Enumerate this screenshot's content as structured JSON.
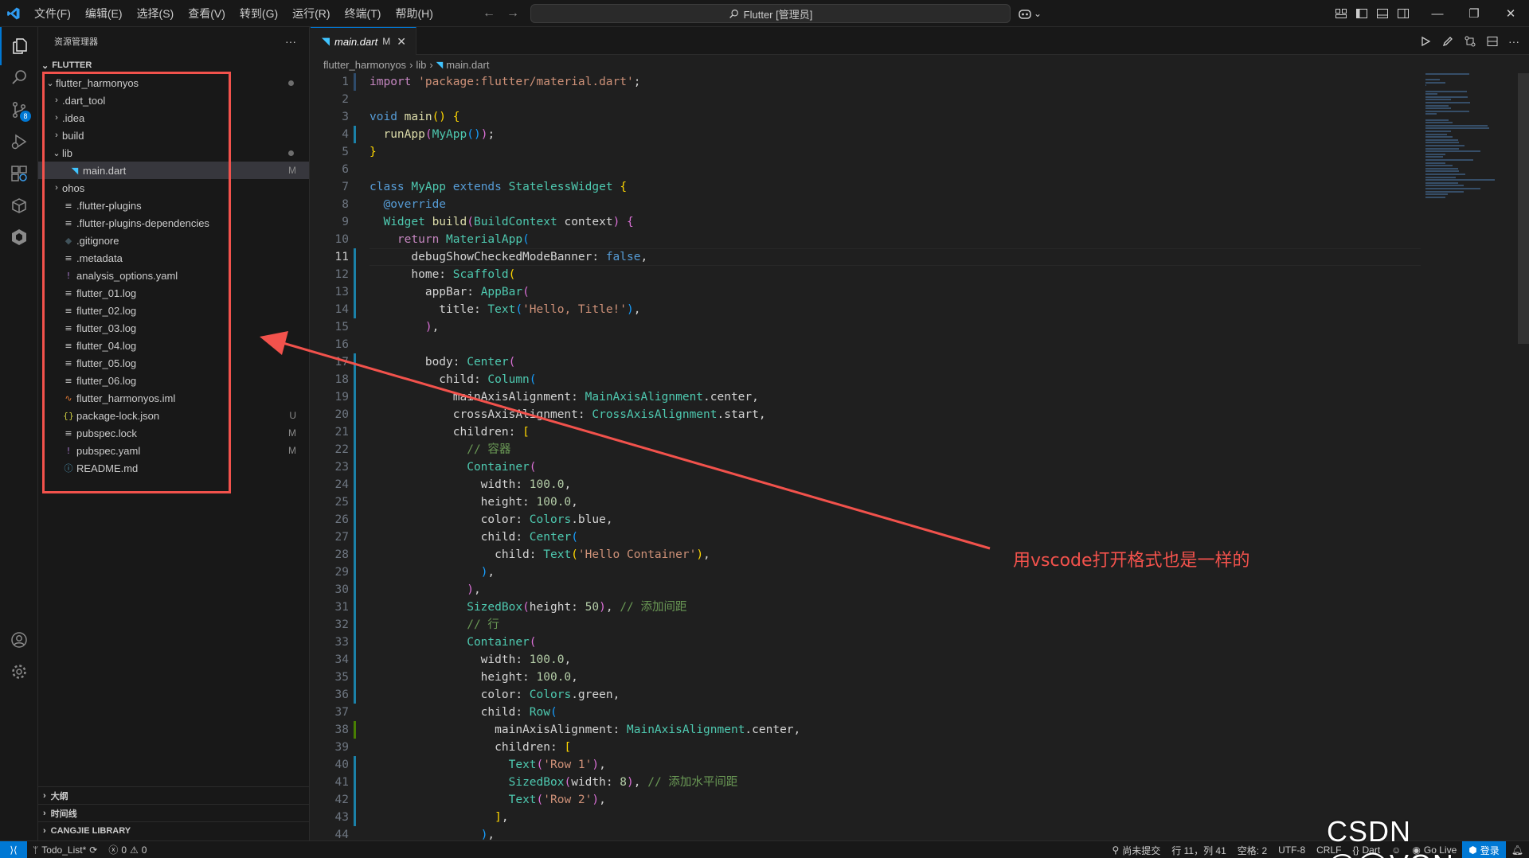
{
  "titlebar": {
    "menus": [
      "文件(F)",
      "编辑(E)",
      "选择(S)",
      "查看(V)",
      "转到(G)",
      "运行(R)",
      "终端(T)",
      "帮助(H)"
    ],
    "command_center": "Flutter [管理员]"
  },
  "explorer": {
    "title": "资源管理器",
    "workspace": "FLUTTER",
    "items": [
      {
        "label": "flutter_harmonyos",
        "depth": 0,
        "kind": "folder-open",
        "dot": true
      },
      {
        "label": ".dart_tool",
        "depth": 1,
        "kind": "folder"
      },
      {
        "label": ".idea",
        "depth": 1,
        "kind": "folder"
      },
      {
        "label": "build",
        "depth": 1,
        "kind": "folder"
      },
      {
        "label": "lib",
        "depth": 1,
        "kind": "folder-open",
        "dot": true
      },
      {
        "label": "main.dart",
        "depth": 2,
        "kind": "dart",
        "status": "M",
        "selected": true
      },
      {
        "label": "ohos",
        "depth": 1,
        "kind": "folder"
      },
      {
        "label": ".flutter-plugins",
        "depth": 1,
        "kind": "text"
      },
      {
        "label": ".flutter-plugins-dependencies",
        "depth": 1,
        "kind": "text"
      },
      {
        "label": ".gitignore",
        "depth": 1,
        "kind": "git"
      },
      {
        "label": ".metadata",
        "depth": 1,
        "kind": "text"
      },
      {
        "label": "analysis_options.yaml",
        "depth": 1,
        "kind": "yaml"
      },
      {
        "label": "flutter_01.log",
        "depth": 1,
        "kind": "text"
      },
      {
        "label": "flutter_02.log",
        "depth": 1,
        "kind": "text"
      },
      {
        "label": "flutter_03.log",
        "depth": 1,
        "kind": "text"
      },
      {
        "label": "flutter_04.log",
        "depth": 1,
        "kind": "text"
      },
      {
        "label": "flutter_05.log",
        "depth": 1,
        "kind": "text"
      },
      {
        "label": "flutter_06.log",
        "depth": 1,
        "kind": "text"
      },
      {
        "label": "flutter_harmonyos.iml",
        "depth": 1,
        "kind": "rss"
      },
      {
        "label": "package-lock.json",
        "depth": 1,
        "kind": "json",
        "status": "U"
      },
      {
        "label": "pubspec.lock",
        "depth": 1,
        "kind": "text",
        "status": "M"
      },
      {
        "label": "pubspec.yaml",
        "depth": 1,
        "kind": "yaml",
        "status": "M"
      },
      {
        "label": "README.md",
        "depth": 1,
        "kind": "info"
      }
    ],
    "bottom_sections": [
      "大纲",
      "时间线",
      "CANGJIE LIBRARY"
    ]
  },
  "activity": {
    "source_control_badge": "8"
  },
  "tab": {
    "label": "main.dart",
    "modified": "M"
  },
  "breadcrumbs": [
    "flutter_harmonyos",
    "lib",
    "main.dart"
  ],
  "editor": {
    "current_line": 11,
    "lines": [
      [
        [
          "kw2",
          "import "
        ],
        [
          "str",
          "'package:flutter/material.dart'"
        ],
        [
          "df",
          ";"
        ]
      ],
      [],
      [
        [
          "kw",
          "void "
        ],
        [
          "fn",
          "main"
        ],
        [
          "br1",
          "()"
        ],
        [
          "df",
          " "
        ],
        [
          "br1",
          "{"
        ]
      ],
      [
        [
          "df",
          "  "
        ],
        [
          "fn",
          "runApp"
        ],
        [
          "br2",
          "("
        ],
        [
          "ty",
          "MyApp"
        ],
        [
          "br3",
          "()"
        ],
        [
          "br2",
          ")"
        ],
        [
          "df",
          ";"
        ]
      ],
      [
        [
          "br1",
          "}"
        ]
      ],
      [],
      [
        [
          "kw",
          "class "
        ],
        [
          "ty",
          "MyApp "
        ],
        [
          "kw",
          "extends "
        ],
        [
          "ty",
          "StatelessWidget "
        ],
        [
          "br1",
          "{"
        ]
      ],
      [
        [
          "df",
          "  "
        ],
        [
          "kw",
          "@override"
        ]
      ],
      [
        [
          "df",
          "  "
        ],
        [
          "ty",
          "Widget "
        ],
        [
          "fn",
          "build"
        ],
        [
          "br2",
          "("
        ],
        [
          "ty",
          "BuildContext "
        ],
        [
          "df",
          "context"
        ],
        [
          "br2",
          ")"
        ],
        [
          "df",
          " "
        ],
        [
          "br2",
          "{"
        ]
      ],
      [
        [
          "df",
          "    "
        ],
        [
          "kw2",
          "return "
        ],
        [
          "ty",
          "MaterialApp"
        ],
        [
          "br3",
          "("
        ]
      ],
      [
        [
          "df",
          "      debugShowCheckedModeBanner: "
        ],
        [
          "kw",
          "false"
        ],
        [
          "df",
          ","
        ]
      ],
      [
        [
          "df",
          "      home: "
        ],
        [
          "ty",
          "Scaffold"
        ],
        [
          "br1",
          "("
        ]
      ],
      [
        [
          "df",
          "        appBar: "
        ],
        [
          "ty",
          "AppBar"
        ],
        [
          "br2",
          "("
        ]
      ],
      [
        [
          "df",
          "          title: "
        ],
        [
          "ty",
          "Text"
        ],
        [
          "br3",
          "("
        ],
        [
          "str",
          "'Hello, Title!'"
        ],
        [
          "br3",
          ")"
        ],
        [
          "df",
          ","
        ]
      ],
      [
        [
          "df",
          "        "
        ],
        [
          "br2",
          ")"
        ],
        [
          "df",
          ","
        ]
      ],
      [],
      [
        [
          "df",
          "        body: "
        ],
        [
          "ty",
          "Center"
        ],
        [
          "br2",
          "("
        ]
      ],
      [
        [
          "df",
          "          child: "
        ],
        [
          "ty",
          "Column"
        ],
        [
          "br3",
          "("
        ]
      ],
      [
        [
          "df",
          "            mainAxisAlignment: "
        ],
        [
          "ty",
          "MainAxisAlignment"
        ],
        [
          "df",
          ".center,"
        ]
      ],
      [
        [
          "df",
          "            crossAxisAlignment: "
        ],
        [
          "ty",
          "CrossAxisAlignment"
        ],
        [
          "df",
          ".start,"
        ]
      ],
      [
        [
          "df",
          "            children: "
        ],
        [
          "br1",
          "["
        ]
      ],
      [
        [
          "df",
          "              "
        ],
        [
          "cm",
          "// 容器"
        ]
      ],
      [
        [
          "df",
          "              "
        ],
        [
          "ty",
          "Container"
        ],
        [
          "br2",
          "("
        ]
      ],
      [
        [
          "df",
          "                width: "
        ],
        [
          "num",
          "100.0"
        ],
        [
          "df",
          ","
        ]
      ],
      [
        [
          "df",
          "                height: "
        ],
        [
          "num",
          "100.0"
        ],
        [
          "df",
          ","
        ]
      ],
      [
        [
          "df",
          "                color: "
        ],
        [
          "ty",
          "Colors"
        ],
        [
          "df",
          ".blue,"
        ]
      ],
      [
        [
          "df",
          "                child: "
        ],
        [
          "ty",
          "Center"
        ],
        [
          "br3",
          "("
        ]
      ],
      [
        [
          "df",
          "                  child: "
        ],
        [
          "ty",
          "Text"
        ],
        [
          "br1",
          "("
        ],
        [
          "str",
          "'Hello Container'"
        ],
        [
          "br1",
          ")"
        ],
        [
          "df",
          ","
        ]
      ],
      [
        [
          "df",
          "                "
        ],
        [
          "br3",
          ")"
        ],
        [
          "df",
          ","
        ]
      ],
      [
        [
          "df",
          "              "
        ],
        [
          "br2",
          ")"
        ],
        [
          "df",
          ","
        ]
      ],
      [
        [
          "df",
          "              "
        ],
        [
          "ty",
          "SizedBox"
        ],
        [
          "br2",
          "("
        ],
        [
          "df",
          "height: "
        ],
        [
          "num",
          "50"
        ],
        [
          "br2",
          ")"
        ],
        [
          "df",
          ", "
        ],
        [
          "cm",
          "// 添加间距"
        ]
      ],
      [
        [
          "df",
          "              "
        ],
        [
          "cm",
          "// 行"
        ]
      ],
      [
        [
          "df",
          "              "
        ],
        [
          "ty",
          "Container"
        ],
        [
          "br2",
          "("
        ]
      ],
      [
        [
          "df",
          "                width: "
        ],
        [
          "num",
          "100.0"
        ],
        [
          "df",
          ","
        ]
      ],
      [
        [
          "df",
          "                height: "
        ],
        [
          "num",
          "100.0"
        ],
        [
          "df",
          ","
        ]
      ],
      [
        [
          "df",
          "                color: "
        ],
        [
          "ty",
          "Colors"
        ],
        [
          "df",
          ".green,"
        ]
      ],
      [
        [
          "df",
          "                child: "
        ],
        [
          "ty",
          "Row"
        ],
        [
          "br3",
          "("
        ]
      ],
      [
        [
          "df",
          "                  mainAxisAlignment: "
        ],
        [
          "ty",
          "MainAxisAlignment"
        ],
        [
          "df",
          ".center,"
        ]
      ],
      [
        [
          "df",
          "                  children: "
        ],
        [
          "br1",
          "["
        ]
      ],
      [
        [
          "df",
          "                    "
        ],
        [
          "ty",
          "Text"
        ],
        [
          "br2",
          "("
        ],
        [
          "str",
          "'Row 1'"
        ],
        [
          "br2",
          ")"
        ],
        [
          "df",
          ","
        ]
      ],
      [
        [
          "df",
          "                    "
        ],
        [
          "ty",
          "SizedBox"
        ],
        [
          "br2",
          "("
        ],
        [
          "df",
          "width: "
        ],
        [
          "num",
          "8"
        ],
        [
          "br2",
          ")"
        ],
        [
          "df",
          ", "
        ],
        [
          "cm",
          "// 添加水平间距"
        ]
      ],
      [
        [
          "df",
          "                    "
        ],
        [
          "ty",
          "Text"
        ],
        [
          "br2",
          "("
        ],
        [
          "str",
          "'Row 2'"
        ],
        [
          "br2",
          ")"
        ],
        [
          "df",
          ","
        ]
      ],
      [
        [
          "df",
          "                  "
        ],
        [
          "br1",
          "]"
        ],
        [
          "df",
          ","
        ]
      ],
      [
        [
          "df",
          "                "
        ],
        [
          "br3",
          ")"
        ],
        [
          "df",
          ","
        ]
      ]
    ]
  },
  "statusbar": {
    "branch": "Todo_List*",
    "problems": "0",
    "warnings": "0",
    "uncommitted": "尚未提交",
    "position": "行 11，列 41",
    "spaces": "空格: 2",
    "encoding": "UTF-8",
    "eol": "CRLF",
    "language": "Dart",
    "golive": "Go Live",
    "login": "登录"
  },
  "annotation": {
    "text": "用vscode打开格式也是一样的"
  },
  "watermark": "CSDN @◯VON",
  "colors": {
    "accent": "#0078d4",
    "annotation": "#f2524c"
  }
}
